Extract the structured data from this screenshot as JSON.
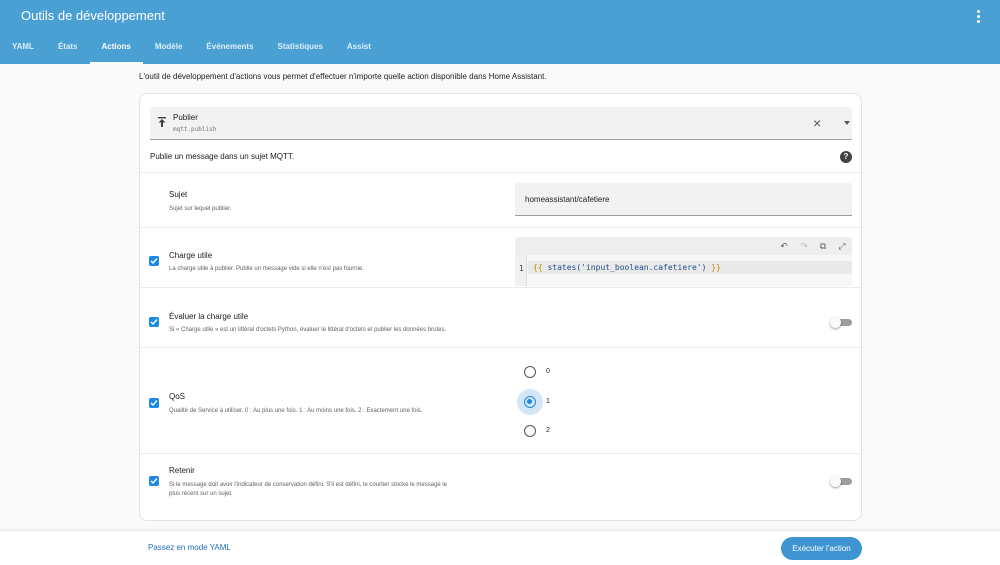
{
  "app": {
    "title": "Outils de développement",
    "menu_icon": "dots-vertical-icon",
    "accent_color": "#4aa0d3"
  },
  "tabs": [
    {
      "label": "YAML",
      "active": false
    },
    {
      "label": "États",
      "active": false
    },
    {
      "label": "Actions",
      "active": true
    },
    {
      "label": "Modèle",
      "active": false
    },
    {
      "label": "Événements",
      "active": false
    },
    {
      "label": "Statistiques",
      "active": false
    },
    {
      "label": "Assist",
      "active": false
    }
  ],
  "intro": "L'outil de développement d'actions vous permet d'effectuer n'importe quelle action disponible dans Home Assistant.",
  "service": {
    "name": "Publier",
    "id": "mqtt.publish",
    "icon": "publish-icon",
    "description": "Publie un message dans un sujet MQTT."
  },
  "fields": {
    "topic": {
      "label": "Sujet",
      "description": "Sujet sur lequel publier.",
      "value": "homeassistant/cafetiere"
    },
    "payload": {
      "label": "Charge utile",
      "description": "La charge utile à publier. Publie un message vide si elle n'est pas fournie.",
      "checked": true,
      "line_number": "1",
      "code_open": "{{",
      "code_body": " states('input_boolean.cafetiere') ",
      "code_close": "}}"
    },
    "evaluate": {
      "label": "Évaluer la charge utile",
      "description": "Si « Charge utile » est un littéral d'octets Python, évaluer le littéral d'octets et publier les données brutes.",
      "checked": true,
      "toggle_on": false
    },
    "qos": {
      "label": "QoS",
      "description": "Qualité de Service à utiliser. 0 : Au plus une fois. 1 : Au moins une fois. 2 : Exactement une fois.",
      "checked": true,
      "options": [
        "0",
        "1",
        "2"
      ],
      "selected": "1"
    },
    "retain": {
      "label": "Retenir",
      "description_line1": "Si le message doit avoir l'indicateur de conservation défini. S'il est défini, le courtier stocke le message le",
      "description_line2": "plus récent sur un sujet.",
      "checked": true,
      "toggle_on": false
    }
  },
  "footer": {
    "yaml_mode_label": "Passez en mode YAML",
    "run_label": "Exécuter l'action"
  }
}
